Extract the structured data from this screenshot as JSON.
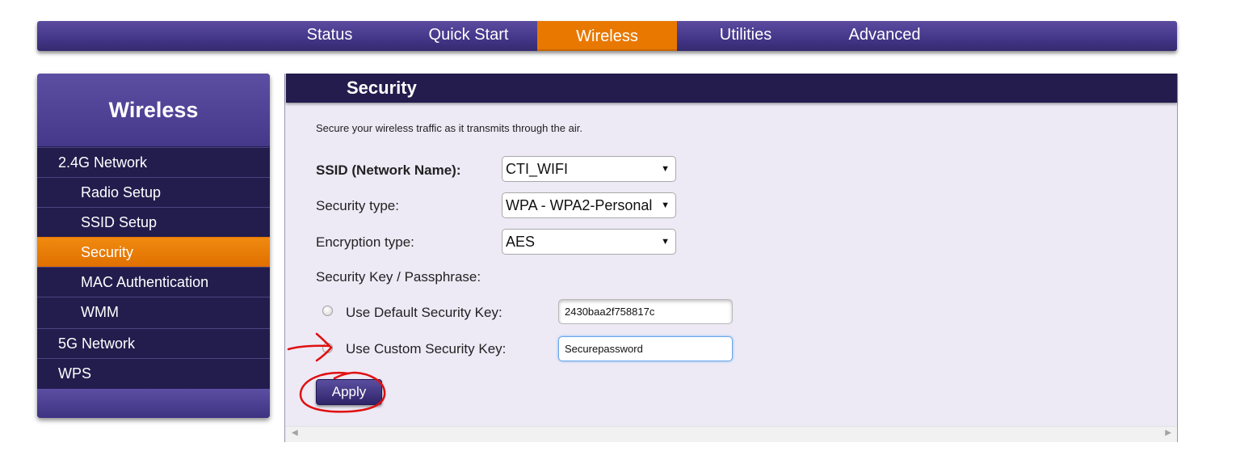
{
  "topnav": {
    "tabs": [
      {
        "label": "Status"
      },
      {
        "label": "Quick Start"
      },
      {
        "label": "Wireless",
        "active": true
      },
      {
        "label": "Utilities"
      },
      {
        "label": "Advanced"
      }
    ]
  },
  "sidebar": {
    "title": "Wireless",
    "items": [
      {
        "label": "2.4G Network",
        "level": 1
      },
      {
        "label": "Radio Setup",
        "level": 2
      },
      {
        "label": "SSID Setup",
        "level": 2
      },
      {
        "label": "Security",
        "level": 2,
        "active": true
      },
      {
        "label": "MAC Authentication",
        "level": 2
      },
      {
        "label": "WMM",
        "level": 2
      },
      {
        "label": "5G Network",
        "level": 1
      },
      {
        "label": "WPS",
        "level": 1
      }
    ]
  },
  "main": {
    "title": "Security",
    "description": "Secure your wireless traffic as it transmits through the air.",
    "ssid": {
      "label": "SSID (Network Name):",
      "value": "CTI_WIFI"
    },
    "security_type": {
      "label": "Security type:",
      "value": "WPA - WPA2-Personal"
    },
    "encryption_type": {
      "label": "Encryption type:",
      "value": "AES"
    },
    "key_section_label": "Security Key / Passphrase:",
    "default_key": {
      "label": "Use Default Security Key:",
      "value": "2430baa2f758817c"
    },
    "custom_key": {
      "label": "Use Custom Security Key:",
      "value": "Securepassword"
    },
    "apply_label": "Apply",
    "dropdown_arrow": "▼"
  },
  "scrollbar": {
    "left_arrow": "◀",
    "right_arrow": "▶"
  },
  "colors": {
    "nav_purple": "#45378a",
    "active_orange": "#e87800",
    "sidebar_dark": "#221d4d",
    "panel_bg": "#edeaf6",
    "annotation_red": "#e01010"
  }
}
